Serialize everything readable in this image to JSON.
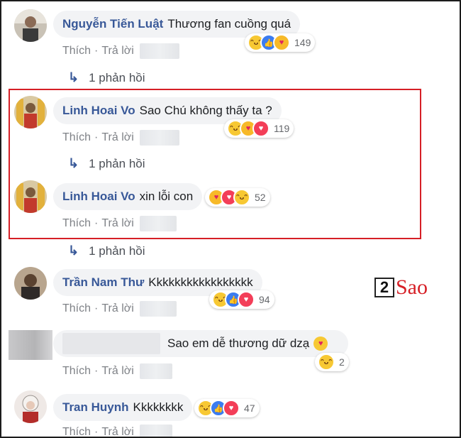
{
  "labels": {
    "like": "Thích",
    "reply": "Trả lời",
    "separator": "·"
  },
  "comments": [
    {
      "name": "Nguyễn Tiến Luật",
      "text": "Thương fan cuồng quá",
      "count": "149",
      "reactions": [
        "haha",
        "like",
        "care"
      ]
    },
    {
      "name": "Linh Hoai Vo",
      "text": "Sao Chú không thấy ta ?",
      "count": "119",
      "reactions": [
        "haha",
        "care",
        "love"
      ]
    },
    {
      "name": "Linh Hoai Vo",
      "text": "xin lỗi con",
      "count": "52",
      "reactions": [
        "care",
        "love",
        "haha"
      ]
    },
    {
      "name": "Trần Nam Thư",
      "text": "Kkkkkkkkkkkkkkkkk",
      "count": "94",
      "reactions": [
        "haha",
        "like",
        "love"
      ]
    },
    {
      "name": "",
      "text": "Sao em dễ thương dữ dzạ",
      "count": "2",
      "reactions": [
        "haha"
      ]
    },
    {
      "name": "Tran Huynh",
      "text": "Kkkkkkkk",
      "count": "47",
      "reactions": [
        "haha",
        "like",
        "love"
      ]
    }
  ],
  "reply_links": [
    "1 phản hồi",
    "1 phản hồi",
    "1 phản hồi"
  ],
  "watermark": {
    "digit": "2",
    "text": "Sao"
  },
  "colors": {
    "name": "#385898",
    "highlight_border": "#d61f26",
    "watermark": "#d61f26"
  }
}
